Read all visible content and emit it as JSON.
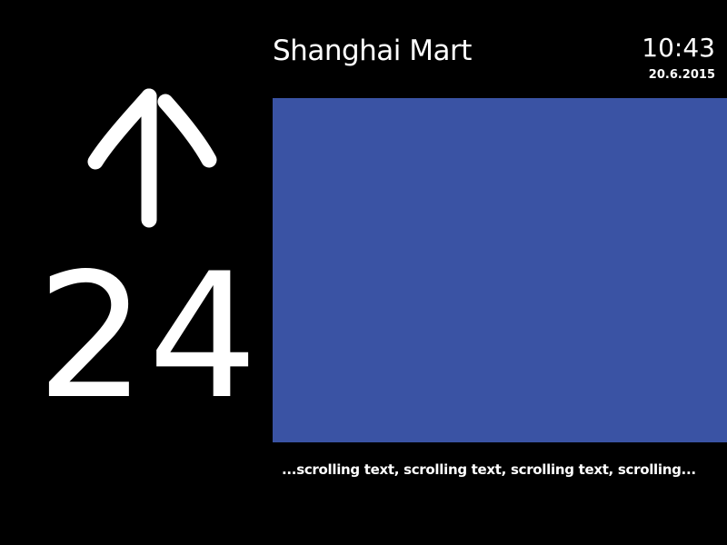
{
  "display": {
    "building_name": "Shanghai Mart",
    "time": "10:43",
    "date": "20.6.2015",
    "direction": "up",
    "direction_icon": "arrow-up-icon",
    "floor": "24",
    "ticker_text": "...scrolling text, scrolling text, scrolling text, scrolling..."
  },
  "colors": {
    "background": "#000000",
    "text": "#ffffff",
    "media_area": "#3a53a4"
  }
}
